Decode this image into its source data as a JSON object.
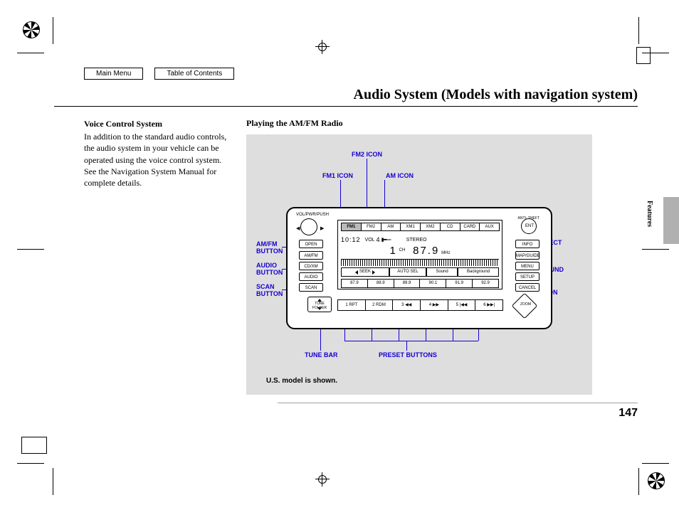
{
  "nav": {
    "main_menu": "Main Menu",
    "toc": "Table of Contents"
  },
  "page_title": "Audio System (Models with navigation system)",
  "left_column": {
    "heading": "Voice Control System",
    "body": "In addition to the standard audio controls, the audio system in your vehicle can be operated using the voice control system. See the Navigation System Manual for complete details."
  },
  "right_column": {
    "heading": "Playing the AM/FM Radio"
  },
  "callouts": {
    "fm1_icon": "FM1 ICON",
    "fm2_icon": "FM2 ICON",
    "am_icon": "AM ICON",
    "amfm_button": "AM/FM BUTTON",
    "audio_button": "AUDIO BUTTON",
    "scan_button": "SCAN BUTTON",
    "auto_select_icon": "AUTO SELECT ICON",
    "background_icon": "BACKGROUND ICON",
    "sound_icon": "SOUND ICON",
    "tune_bar": "TUNE BAR",
    "preset_buttons": "PRESET BUTTONS"
  },
  "footnote": "U.S. model is shown.",
  "page_number": "147",
  "section_tab": "Features",
  "radio": {
    "knob_top_label": "VOL/PWR/PUSH",
    "anti_theft": "ANTI-\nTHEFT",
    "left_buttons": {
      "open": "OPEN",
      "amfm": "AM/FM",
      "cdxm": "CD/XM",
      "audio": "AUDIO",
      "scan": "SCAN"
    },
    "right_buttons": {
      "ent": "ENT",
      "info": "INFO",
      "map": "MAP/GUIDE",
      "menu": "MENU",
      "setup": "SETUP",
      "cancel": "CANCEL"
    },
    "tune_folder": "TUNE\nFOLDER",
    "zoom": "ZOOM",
    "tabs": [
      "FM1",
      "FM2",
      "AM",
      "XM1",
      "XM2",
      "CD",
      "CARD",
      "AUX"
    ],
    "selected_tab": 0,
    "clock": "10:12",
    "vol_label": "VOL",
    "vol_bars": "4",
    "stereo": "STEREO",
    "channel": "1",
    "ch_label": "CH",
    "frequency": "87.9",
    "freq_unit": "MHz",
    "softkeys": {
      "seek": "SEEK",
      "autosel": "AUTO SEL",
      "sound": "Sound",
      "background": "Background"
    },
    "presets": [
      "87.9",
      "88.9",
      "89.9",
      "90.1",
      "91.9",
      "92.9"
    ],
    "bottom_buttons": [
      "1 RPT",
      "2 RDM",
      "3 ◀◀",
      "4 ▶▶",
      "5 |◀◀",
      "6 ▶▶|"
    ]
  }
}
